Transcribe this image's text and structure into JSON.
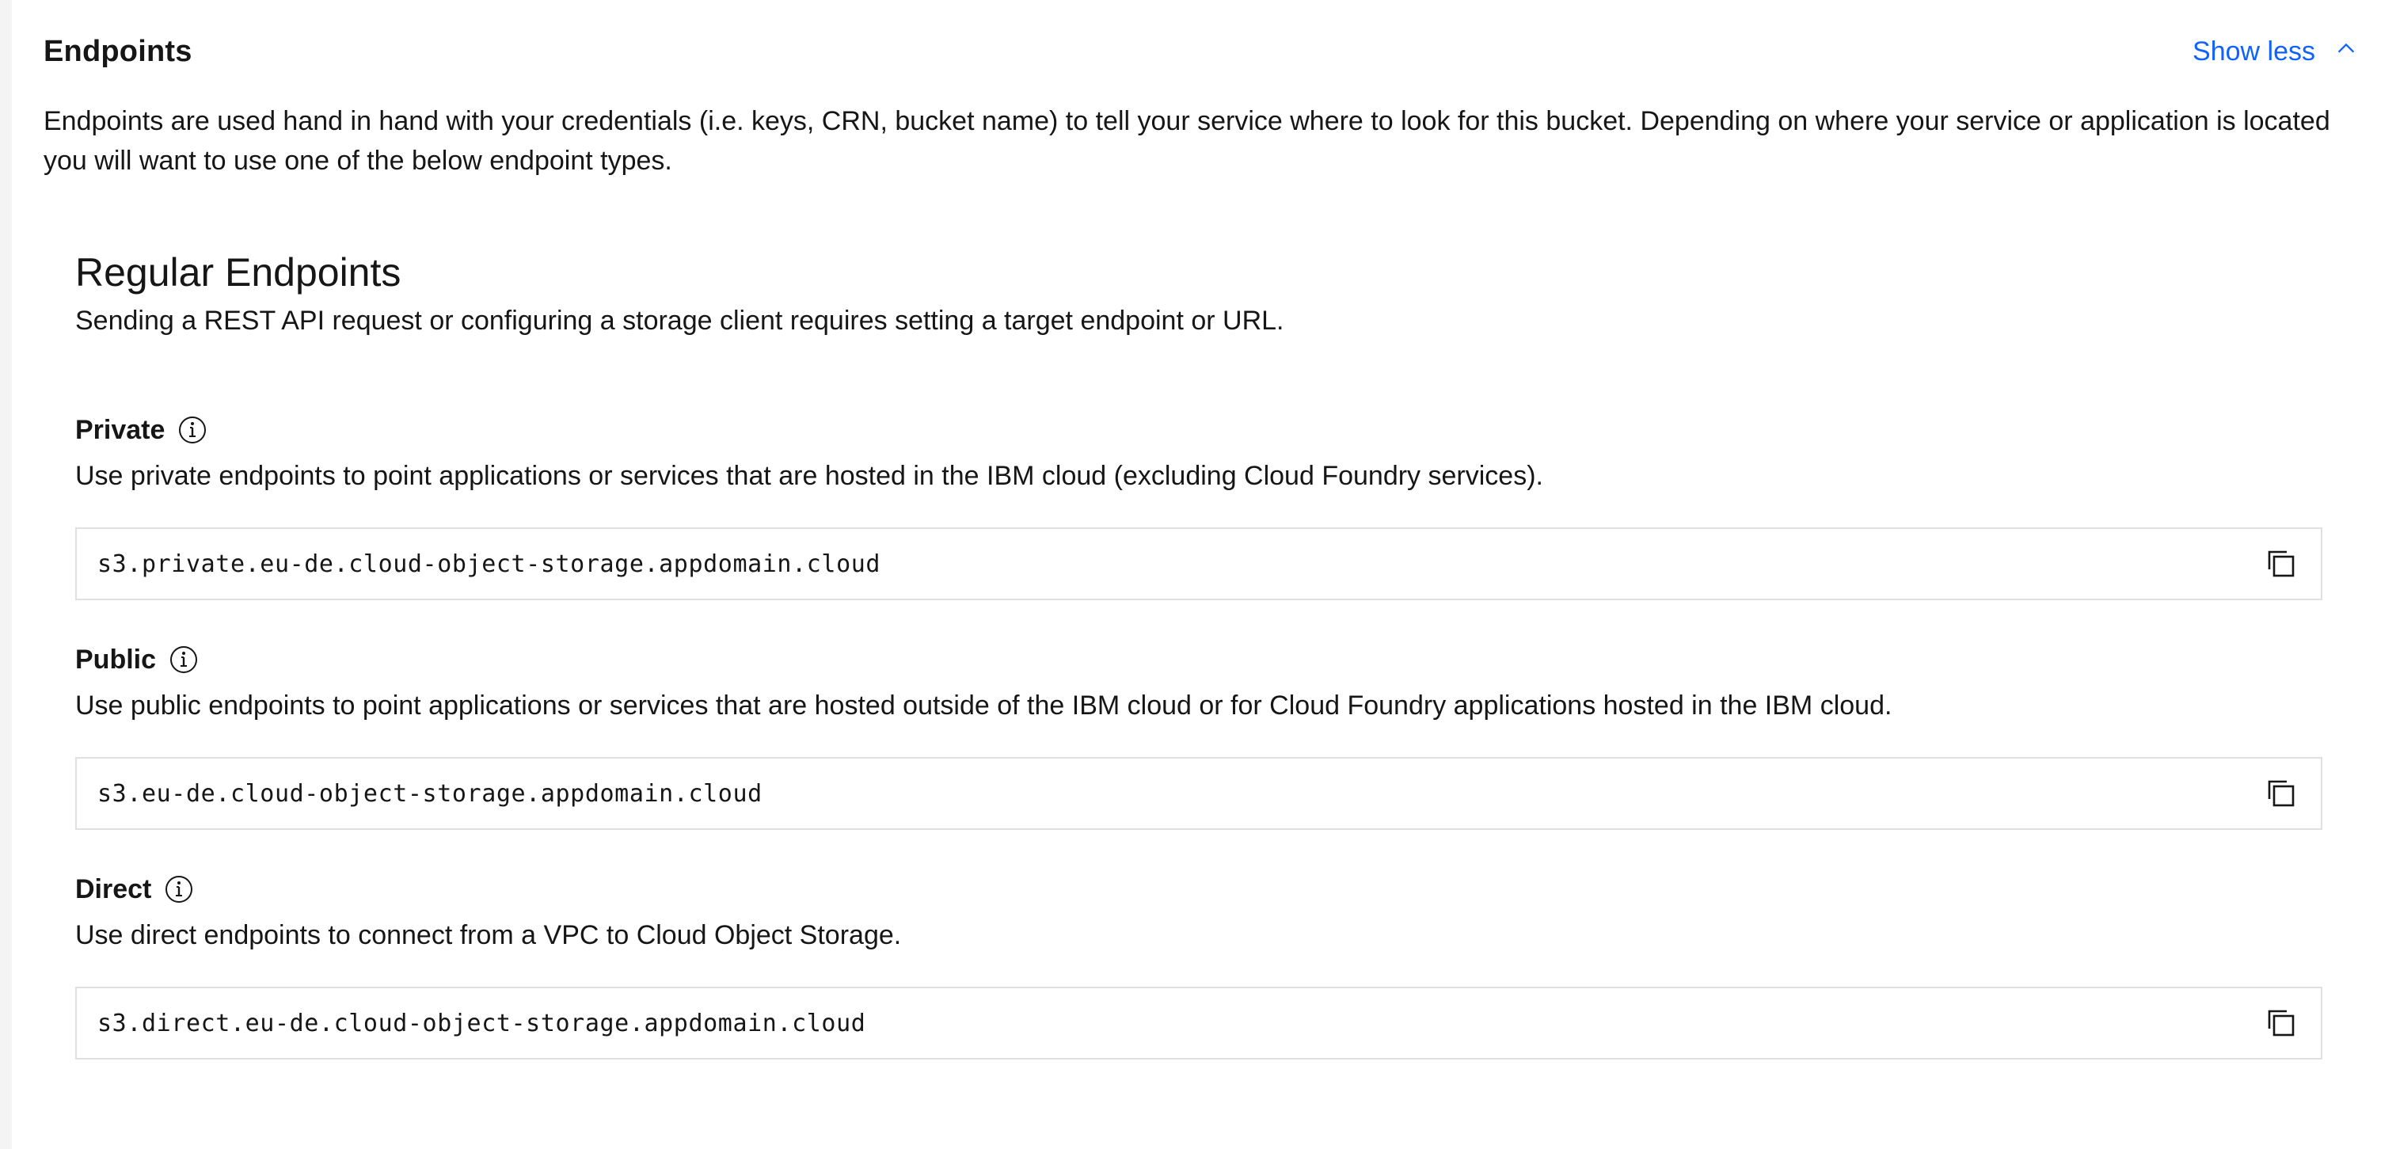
{
  "section": {
    "title": "Endpoints",
    "toggle_label": "Show less",
    "description": "Endpoints are used hand in hand with your credentials (i.e. keys, CRN, bucket name) to tell your service where to look for this bucket. Depending on where your service or application is located you will want to use one of the below endpoint types."
  },
  "regular": {
    "title": "Regular Endpoints",
    "description": "Sending a REST API request or configuring a storage client requires setting a target endpoint or URL."
  },
  "endpoints": [
    {
      "label": "Private",
      "description": "Use private endpoints to point applications or services that are hosted in the IBM cloud (excluding Cloud Foundry services).",
      "value": "s3.private.eu-de.cloud-object-storage.appdomain.cloud"
    },
    {
      "label": "Public",
      "description": "Use public endpoints to point applications or services that are hosted outside of the IBM cloud or for Cloud Foundry applications hosted in the IBM cloud.",
      "value": "s3.eu-de.cloud-object-storage.appdomain.cloud"
    },
    {
      "label": "Direct",
      "description": "Use direct endpoints to connect from a VPC to Cloud Object Storage.",
      "value": "s3.direct.eu-de.cloud-object-storage.appdomain.cloud"
    }
  ],
  "icons": {
    "toggle": "chevron-up-icon",
    "info": "info-icon",
    "copy": "copy-icon"
  },
  "colors": {
    "accent": "#0f62fe",
    "text": "#161616",
    "border": "#e0e0e0",
    "page_background": "#f4f4f4"
  }
}
